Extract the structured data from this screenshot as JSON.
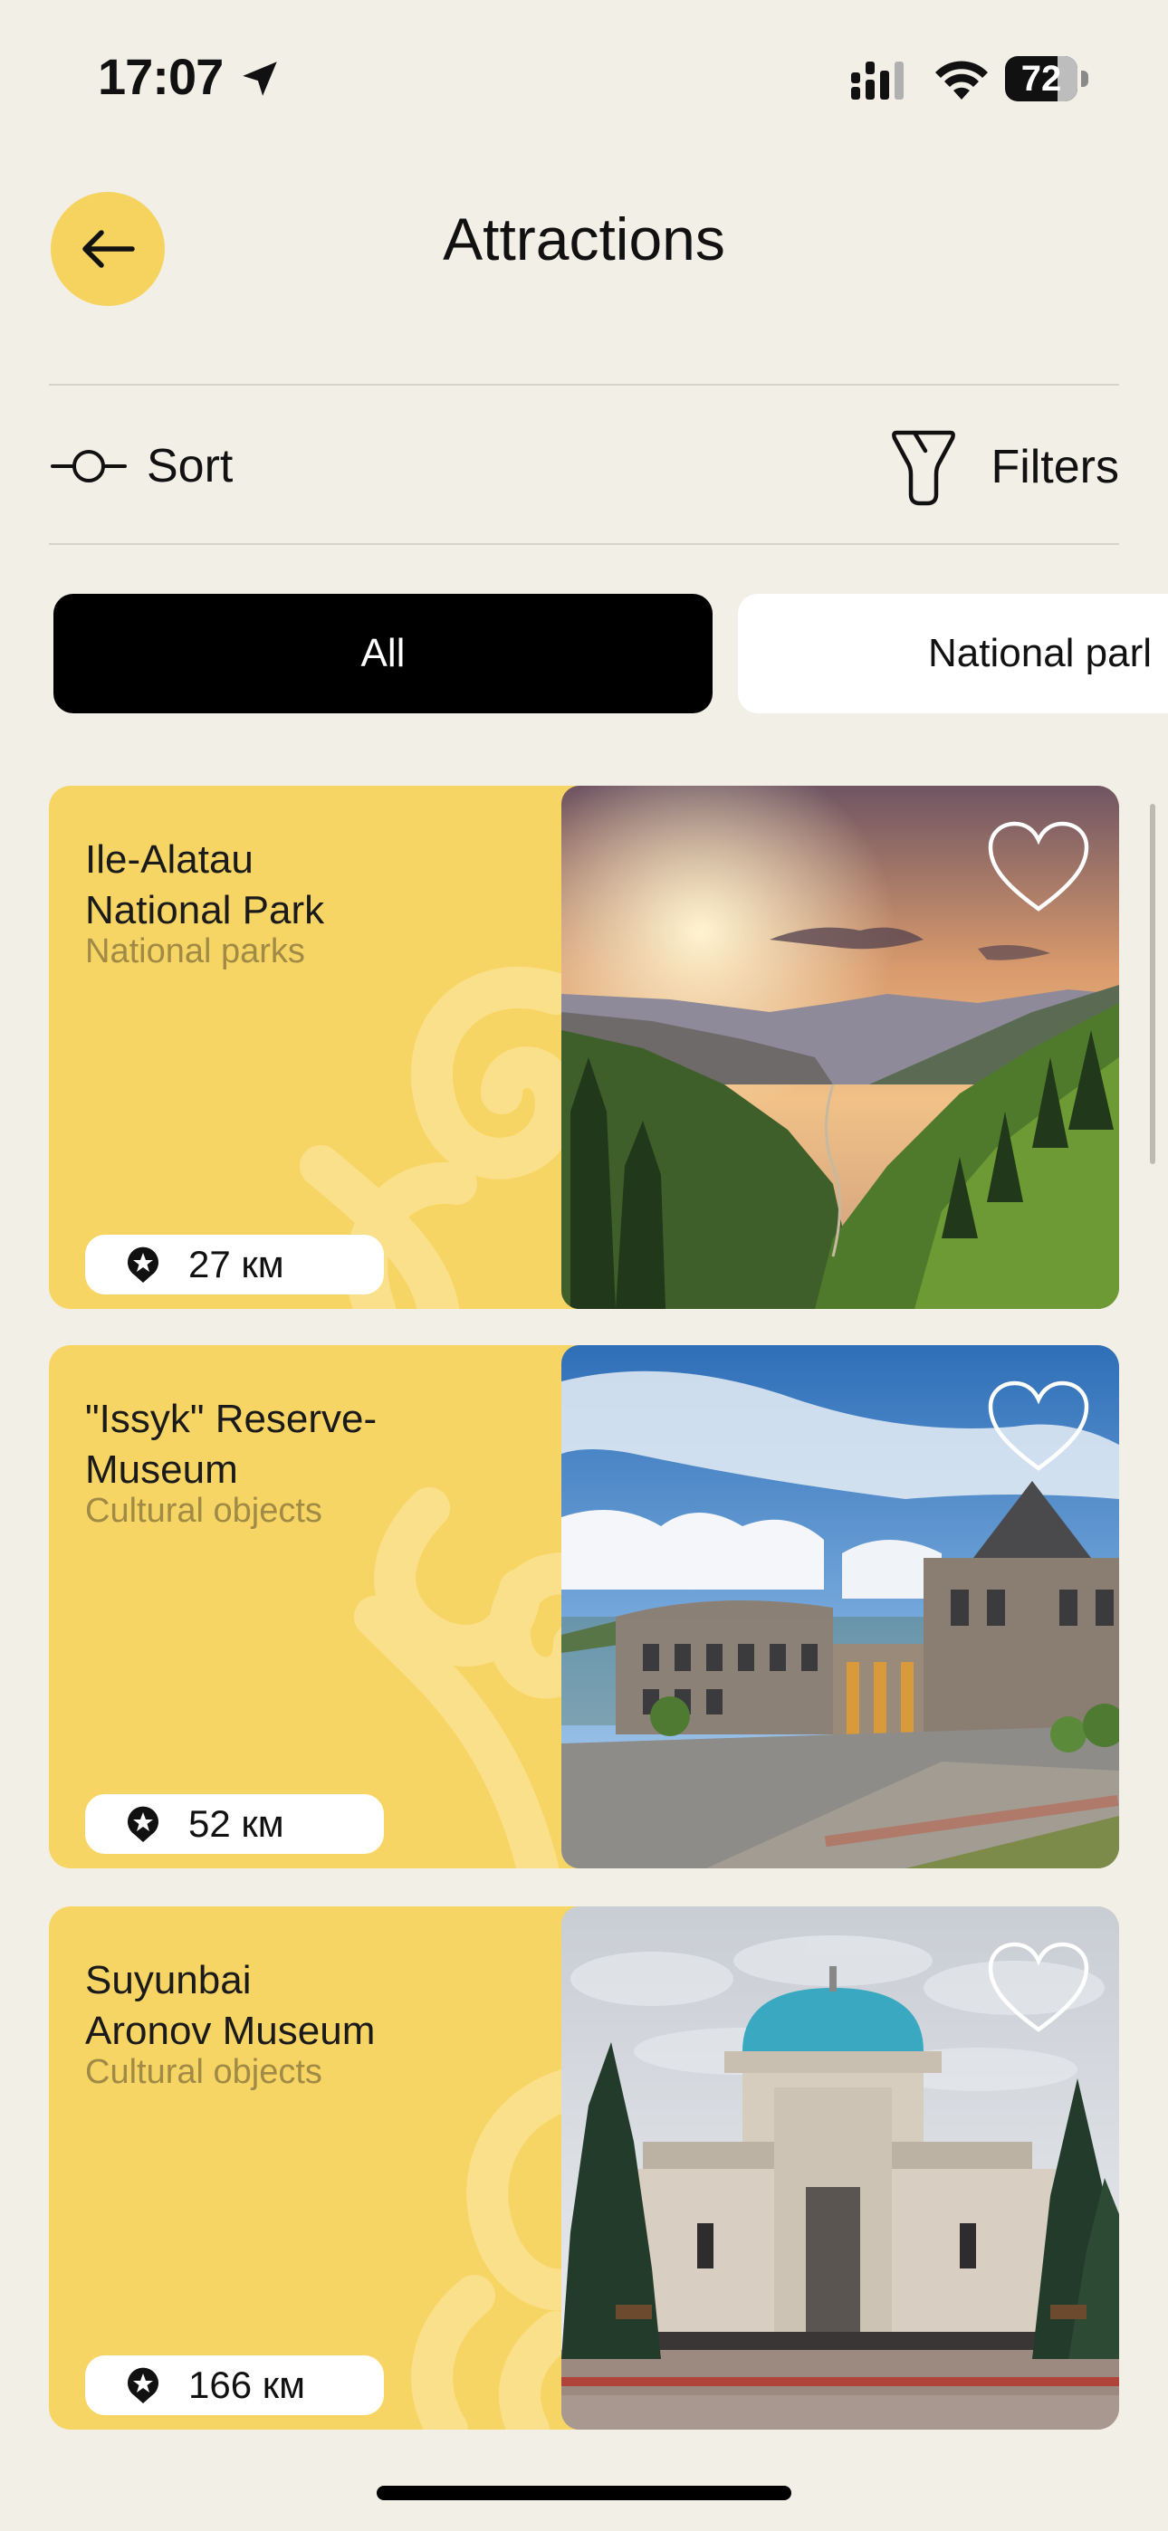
{
  "status_bar": {
    "time": "17:07",
    "battery": "72",
    "battery_level": 0.72
  },
  "header": {
    "title": "Attractions"
  },
  "toolbar": {
    "sort_label": "Sort",
    "filters_label": "Filters"
  },
  "chips": [
    {
      "label": "All",
      "selected": true
    },
    {
      "label": "National parl",
      "selected": false
    }
  ],
  "cards": [
    {
      "title_line1": "Ile-Alatau",
      "title_line2": "National Park",
      "category": "National parks",
      "distance": "27 км"
    },
    {
      "title_line1": "\"Issyk\" Reserve-",
      "title_line2": "Museum",
      "category": "Cultural objects",
      "distance": "52 км"
    },
    {
      "title_line1": "Suyunbai",
      "title_line2": "Aronov Museum",
      "category": "Cultural objects",
      "distance": "166 км"
    }
  ],
  "colors": {
    "background": "#F2EFE6",
    "accent_yellow": "#F5D35E",
    "card_yellow": "#F7D564",
    "category_text": "#A08A45",
    "chip_selected": "#000000"
  },
  "icons": [
    "back-arrow-icon",
    "location-arrow-icon",
    "signal-icon",
    "wifi-icon",
    "battery-icon",
    "sort-icon",
    "filter-icon",
    "heart-icon",
    "map-pin-star-icon"
  ]
}
